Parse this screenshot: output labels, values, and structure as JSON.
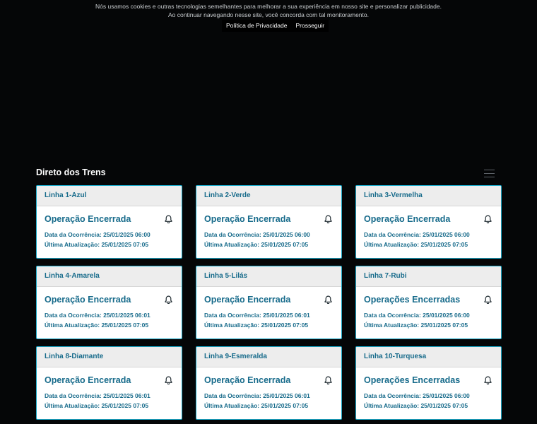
{
  "cookie": {
    "line1": "Nós usamos cookies e outras tecnologias semelhantes para melhorar a sua experiência em nosso site e personalizar publicidade.",
    "line2": "Ao continuar navegando nesse site, você concorda com tal monitoramento.",
    "privacy_label": "Política de Privacidade",
    "proceed_label": "Prosseguir"
  },
  "page": {
    "title": "Direto dos Trens",
    "menu_icon": "hamburger-menu-icon"
  },
  "cards": [
    {
      "line": "Linha 1-Azul",
      "status": "Operação Encerrada",
      "date": "Data da Ocorrência: 25/01/2025 06:00",
      "update": "Última Atualização: 25/01/2025 07:05"
    },
    {
      "line": "Linha 2-Verde",
      "status": "Operação Encerrada",
      "date": "Data da Ocorrência: 25/01/2025 06:00",
      "update": "Última Atualização: 25/01/2025 07:05"
    },
    {
      "line": "Linha 3-Vermelha",
      "status": "Operação Encerrada",
      "date": "Data da Ocorrência: 25/01/2025 06:00",
      "update": "Última Atualização: 25/01/2025 07:05"
    },
    {
      "line": "Linha 4-Amarela",
      "status": "Operação Encerrada",
      "date": "Data da Ocorrência: 25/01/2025 06:01",
      "update": "Última Atualização: 25/01/2025 07:05"
    },
    {
      "line": "Linha 5-Lilás",
      "status": "Operação Encerrada",
      "date": "Data da Ocorrência: 25/01/2025 06:01",
      "update": "Última Atualização: 25/01/2025 07:05"
    },
    {
      "line": "Linha 7-Rubi",
      "status": "Operações Encerradas",
      "date": "Data da Ocorrência: 25/01/2025 06:00",
      "update": "Última Atualização: 25/01/2025 07:05"
    },
    {
      "line": "Linha 8-Diamante",
      "status": "Operação Encerrada",
      "date": "Data da Ocorrência: 25/01/2025 06:01",
      "update": "Última Atualização: 25/01/2025 07:05"
    },
    {
      "line": "Linha 9-Esmeralda",
      "status": "Operação Encerrada",
      "date": "Data da Ocorrência: 25/01/2025 06:01",
      "update": "Última Atualização: 25/01/2025 07:05"
    },
    {
      "line": "Linha 10-Turquesa",
      "status": "Operações Encerradas",
      "date": "Data da Ocorrência: 25/01/2025 06:00",
      "update": "Última Atualização: 25/01/2025 07:05"
    }
  ],
  "colors": {
    "background": "#050607",
    "accent": "#176b8b",
    "card_border": "#1aa9c9"
  }
}
